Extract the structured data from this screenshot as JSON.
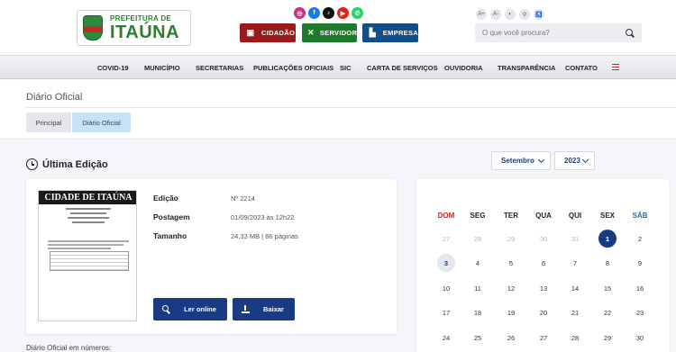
{
  "header": {
    "logo_line1": "PREFEITURA DE",
    "logo_line2": "ITAÚNA",
    "social_icons": [
      "instagram-icon",
      "facebook-icon",
      "tiktok-icon",
      "youtube-icon",
      "whatsapp-icon"
    ],
    "portal_buttons": [
      {
        "label": "CIDADÃO",
        "icon": "person-icon",
        "color": "#9b1b1b"
      },
      {
        "label": "SERVIDOR",
        "icon": "tools-icon",
        "color": "#1f7a2e"
      },
      {
        "label": "EMPRESA",
        "icon": "factory-icon",
        "color": "#124d87"
      }
    ],
    "a11y": [
      "A+",
      "A-",
      "◐",
      "⚲",
      "♿"
    ],
    "search_placeholder": "O que você procura?"
  },
  "nav": {
    "items": [
      "COVID-19",
      "MUNICÍPIO",
      "SECRETARIAS",
      "PUBLICAÇÕES OFICIAIS",
      "SIC",
      "CARTA DE SERVIÇOS",
      "OUVIDORIA",
      "TRANSPARÊNCIA",
      "CONTATO"
    ]
  },
  "page": {
    "title": "Diário Oficial",
    "breadcrumb": [
      "Principal",
      "Diário Oficial"
    ]
  },
  "section": {
    "title": "Última Edição"
  },
  "filters": {
    "month": "Setembro",
    "year": "2023"
  },
  "edition": {
    "masthead": "CIDADE DE ITAÚNA",
    "rows": [
      {
        "label": "Edição",
        "value": "Nº 2214"
      },
      {
        "label": "Postagem",
        "value": "01/09/2023 às 12h22"
      },
      {
        "label": "Tamanho",
        "value": "24,33 MB | 86 páginas"
      }
    ],
    "read_label": "Ler online",
    "download_label": "Baixar"
  },
  "numbers_text": "Diário Oficial em números:",
  "calendar": {
    "weekdays": [
      "DOM",
      "SEG",
      "TER",
      "QUA",
      "QUI",
      "SEX",
      "SÁB"
    ],
    "weeks": [
      [
        "27",
        "28",
        "29",
        "30",
        "31",
        "1",
        "2"
      ],
      [
        "3",
        "4",
        "5",
        "6",
        "7",
        "8",
        "9"
      ],
      [
        "10",
        "11",
        "12",
        "13",
        "14",
        "15",
        "16"
      ],
      [
        "17",
        "18",
        "19",
        "20",
        "21",
        "22",
        "23"
      ],
      [
        "24",
        "25",
        "26",
        "27",
        "28",
        "29",
        "30"
      ]
    ],
    "muted": [
      "0-0",
      "0-1",
      "0-2",
      "0-3",
      "0-4"
    ],
    "selected": "0-5",
    "highlighted": "1-0"
  },
  "colors": {
    "primary": "#183b84",
    "cidadao": "#9b1b1b",
    "servidor": "#1f7a2e",
    "empresa": "#124d87",
    "sunday": "#c62828",
    "saturday": "#2a6cb5"
  }
}
